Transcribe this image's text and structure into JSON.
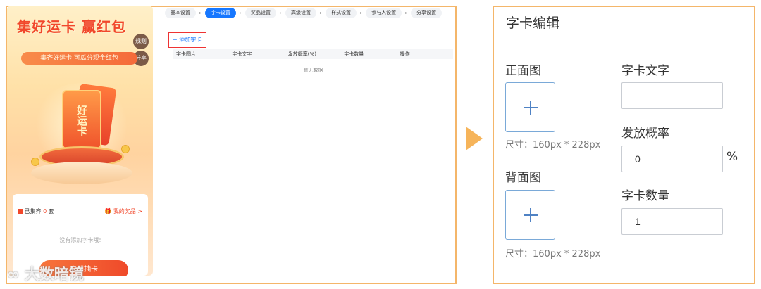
{
  "preview": {
    "title": "集好运卡 赢红包",
    "rule_label": "规则",
    "share_label": "分享",
    "subtitle": "集齐好运卡 可瓜分现金红包",
    "card_text": "好运卡",
    "collected_prefix": "已集齐",
    "collected_count": "0",
    "collected_unit": "套",
    "my_prize": "我的奖品 >",
    "empty_text": "没有添加字卡哦!",
    "button_label": "立即抽卡"
  },
  "watermark": "大数暗镜",
  "steps": [
    {
      "label": "基本设置",
      "active": false
    },
    {
      "label": "字卡设置",
      "active": true
    },
    {
      "label": "奖品设置",
      "active": false
    },
    {
      "label": "高级设置",
      "active": false
    },
    {
      "label": "样式设置",
      "active": false
    },
    {
      "label": "参与人设置",
      "active": false
    },
    {
      "label": "分享设置",
      "active": false
    }
  ],
  "add_card_button": "+ 添加字卡",
  "table": {
    "columns": [
      "字卡图片",
      "字卡文字",
      "发放概率(%)",
      "字卡数量",
      "操作"
    ],
    "empty_text": "暂无数据"
  },
  "editor": {
    "title": "字卡编辑",
    "front_label": "正面图",
    "back_label": "背面图",
    "size_hint": "尺寸：160px * 228px",
    "text_label": "字卡文字",
    "text_value": "",
    "prob_label": "发放概率",
    "prob_value": "0",
    "prob_unit": "%",
    "count_label": "字卡数量",
    "count_value": "1"
  },
  "colors": {
    "frame": "#f4b66a",
    "accent_blue": "#1677ff",
    "highlight_red": "#e33333",
    "arrow": "#f6b45a"
  }
}
